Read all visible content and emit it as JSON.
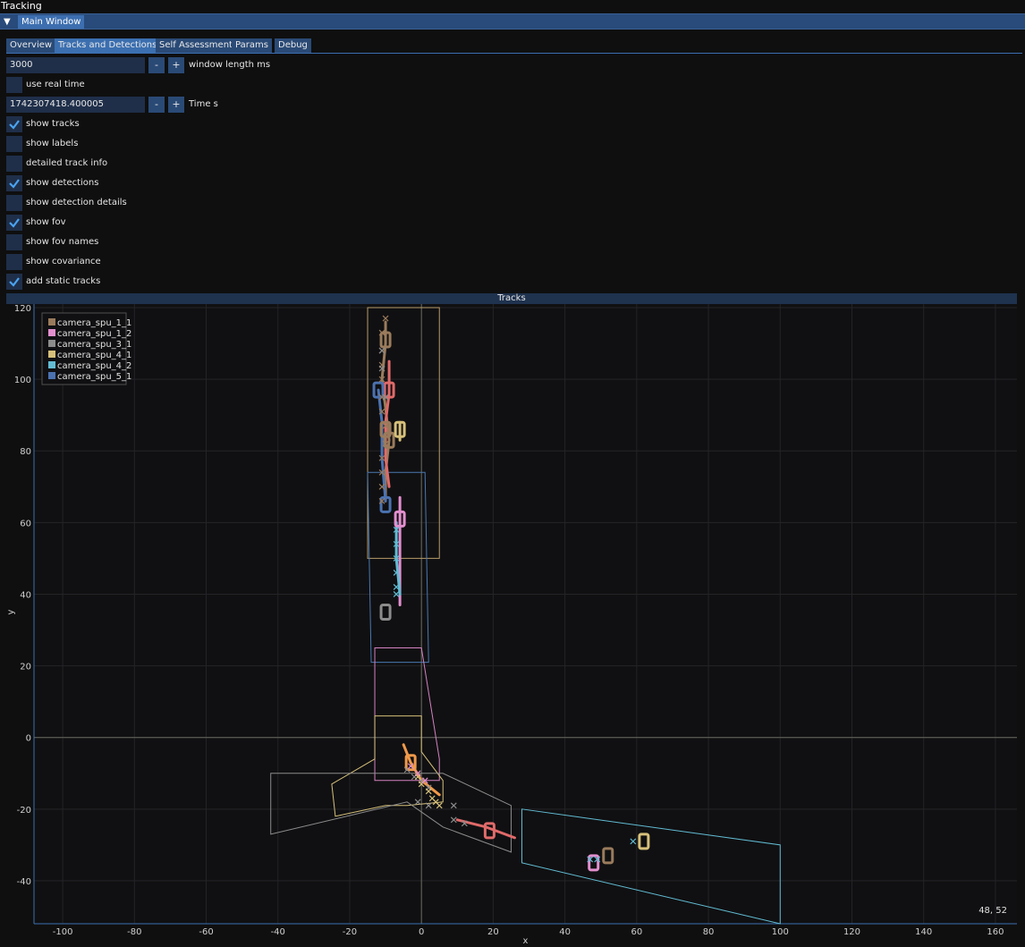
{
  "app": {
    "title": "Tracking"
  },
  "window": {
    "tab_label": "Main Window"
  },
  "tabs": [
    {
      "label": "Overview",
      "active": false
    },
    {
      "label": "Tracks and Detections",
      "active": true
    },
    {
      "label": "Self Assessment",
      "active": false
    },
    {
      "label": "Params",
      "active": false
    },
    {
      "label": "Debug",
      "active": false
    }
  ],
  "controls": {
    "window_length": {
      "value": "3000",
      "label": "window length ms",
      "minus": "-",
      "plus": "+"
    },
    "use_real_time": {
      "label": "use real time",
      "checked": false
    },
    "time": {
      "value": "1742307418.400005",
      "label": "Time s",
      "minus": "-",
      "plus": "+"
    },
    "checkboxes": [
      {
        "label": "show tracks",
        "checked": true
      },
      {
        "label": "show labels",
        "checked": false
      },
      {
        "label": "detailed track info",
        "checked": false
      },
      {
        "label": "show detections",
        "checked": true
      },
      {
        "label": "show detection details",
        "checked": false
      },
      {
        "label": "show fov",
        "checked": true
      },
      {
        "label": "show fov names",
        "checked": false
      },
      {
        "label": "show covariance",
        "checked": false
      },
      {
        "label": "add static tracks",
        "checked": true
      }
    ]
  },
  "plot": {
    "title": "Tracks",
    "cursor_readout": "48, 52"
  },
  "chart_data": {
    "type": "scatter",
    "title": "Tracks",
    "xlabel": "x",
    "ylabel": "y",
    "xlim": [
      -108,
      166
    ],
    "ylim": [
      -52,
      121
    ],
    "xticks": [
      -100,
      -80,
      -60,
      -40,
      -20,
      0,
      20,
      40,
      60,
      80,
      100,
      120,
      140,
      160
    ],
    "yticks": [
      -40,
      -20,
      0,
      20,
      40,
      60,
      80,
      100,
      120
    ],
    "grid": true,
    "legend_position": "top-left",
    "legend": [
      {
        "name": "camera_spu_1_1",
        "color": "#9a7b5c"
      },
      {
        "name": "camera_spu_1_2",
        "color": "#e38fcf"
      },
      {
        "name": "camera_spu_3_1",
        "color": "#8c8c8c"
      },
      {
        "name": "camera_spu_4_1",
        "color": "#d6c07a"
      },
      {
        "name": "camera_spu_4_2",
        "color": "#62bcd3"
      },
      {
        "name": "camera_spu_5_1",
        "color": "#4b72b0"
      }
    ],
    "fovs": [
      {
        "color": "#b89c6a",
        "points": [
          [
            -15,
            120
          ],
          [
            5,
            120
          ],
          [
            5,
            50
          ],
          [
            -15,
            50
          ]
        ]
      },
      {
        "color": "#4a78b0",
        "points": [
          [
            -15,
            74
          ],
          [
            1,
            74
          ],
          [
            2,
            21
          ],
          [
            -14,
            21
          ]
        ]
      },
      {
        "color": "#d582c2",
        "points": [
          [
            -13,
            25
          ],
          [
            0,
            25
          ],
          [
            5,
            -6
          ],
          [
            5,
            -12
          ],
          [
            -13,
            -12
          ]
        ]
      },
      {
        "color": "#d6c07a",
        "points": [
          [
            -13,
            6
          ],
          [
            0,
            6
          ],
          [
            0,
            -4
          ],
          [
            6,
            -12
          ],
          [
            6,
            -18
          ],
          [
            -4,
            -19
          ],
          [
            -10,
            -19
          ],
          [
            -24,
            -22
          ],
          [
            -25,
            -13
          ],
          [
            -13,
            -6
          ]
        ]
      },
      {
        "color": "#8c8c8c",
        "points": [
          [
            -42,
            -10
          ],
          [
            6,
            -10
          ],
          [
            25,
            -19
          ],
          [
            25,
            -32
          ],
          [
            6,
            -25
          ],
          [
            -4,
            -18
          ],
          [
            -42,
            -27
          ]
        ]
      },
      {
        "color": "#62bcd3",
        "points": [
          [
            28,
            -20
          ],
          [
            100,
            -30
          ],
          [
            100,
            -52
          ],
          [
            28,
            -35
          ]
        ]
      }
    ],
    "tracks": [
      {
        "color": "#9a7b5c",
        "points": [
          [
            -10,
            116
          ],
          [
            -10,
            110
          ],
          [
            -11,
            100
          ],
          [
            -10,
            92
          ],
          [
            -9,
            83
          ],
          [
            -10,
            74
          ],
          [
            -10,
            66
          ]
        ]
      },
      {
        "color": "#e06a6a",
        "points": [
          [
            -9,
            105
          ],
          [
            -9,
            96
          ],
          [
            -10,
            88
          ],
          [
            -10,
            78
          ],
          [
            -9,
            70
          ]
        ]
      },
      {
        "color": "#4b72b0",
        "points": [
          [
            -12,
            97
          ],
          [
            -11,
            88
          ],
          [
            -11,
            78
          ],
          [
            -10,
            66
          ]
        ]
      },
      {
        "color": "#e38fcf",
        "points": [
          [
            -6,
            67
          ],
          [
            -6,
            58
          ],
          [
            -6,
            48
          ],
          [
            -6,
            37
          ]
        ]
      },
      {
        "color": "#62bcd3",
        "points": [
          [
            -7,
            60
          ],
          [
            -7,
            50
          ],
          [
            -6,
            40
          ]
        ]
      },
      {
        "color": "#d6c07a",
        "points": [
          [
            -6,
            88
          ],
          [
            -6,
            85
          ],
          [
            -6,
            83
          ]
        ]
      },
      {
        "color": "#f0994a",
        "points": [
          [
            -5,
            -2
          ],
          [
            -3,
            -7
          ],
          [
            0,
            -12
          ],
          [
            5,
            -16
          ]
        ]
      },
      {
        "color": "#e06a6a",
        "points": [
          [
            10,
            -23
          ],
          [
            18,
            -25
          ],
          [
            26,
            -28
          ]
        ]
      }
    ],
    "boxes": [
      {
        "color": "#9a7b5c",
        "points": [
          [
            -10,
            111
          ],
          [
            -10,
            86
          ],
          [
            -9,
            83
          ],
          [
            52,
            -33
          ]
        ]
      },
      {
        "color": "#e06a6a",
        "points": [
          [
            -9,
            97
          ],
          [
            19,
            -26
          ]
        ]
      },
      {
        "color": "#4b72b0",
        "points": [
          [
            -12,
            97
          ],
          [
            -10,
            65
          ]
        ]
      },
      {
        "color": "#e38fcf",
        "points": [
          [
            -6,
            61
          ],
          [
            48,
            -35
          ]
        ]
      },
      {
        "color": "#8c8c8c",
        "points": [
          [
            -10,
            35
          ]
        ]
      },
      {
        "color": "#d6c07a",
        "points": [
          [
            -6,
            86
          ],
          [
            62,
            -29
          ]
        ]
      },
      {
        "color": "#f0994a",
        "points": [
          [
            -3,
            -7
          ]
        ]
      }
    ],
    "detections": [
      {
        "color": "#9a7b5c",
        "points": [
          [
            -10,
            117
          ],
          [
            -11,
            113
          ],
          [
            -11,
            108
          ],
          [
            -11,
            104
          ],
          [
            -11,
            100
          ],
          [
            -11,
            95
          ],
          [
            -11,
            91
          ],
          [
            -10,
            87
          ],
          [
            -10,
            82
          ],
          [
            -11,
            78
          ],
          [
            -11,
            74
          ],
          [
            -11,
            70
          ],
          [
            -11,
            66
          ]
        ]
      },
      {
        "color": "#8c8c8c",
        "points": [
          [
            -11,
            108
          ],
          [
            -11,
            103
          ],
          [
            -10,
            95
          ],
          [
            -4,
            -9
          ],
          [
            -2,
            -11
          ],
          [
            0,
            -12
          ],
          [
            2,
            -14
          ],
          [
            -1,
            -18
          ],
          [
            2,
            -19
          ],
          [
            9,
            -19
          ],
          [
            9,
            -23
          ],
          [
            12,
            -24
          ]
        ]
      },
      {
        "color": "#62bcd3",
        "points": [
          [
            -7,
            58
          ],
          [
            -7,
            54
          ],
          [
            -7,
            50
          ],
          [
            -7,
            46
          ],
          [
            -7,
            42
          ],
          [
            -7,
            40
          ],
          [
            47,
            -34
          ],
          [
            59,
            -29
          ],
          [
            49,
            -34
          ]
        ]
      },
      {
        "color": "#d6c07a",
        "points": [
          [
            -1,
            -11
          ],
          [
            0,
            -13
          ],
          [
            2,
            -15
          ],
          [
            3,
            -17
          ],
          [
            4,
            -18
          ],
          [
            5,
            -19
          ]
        ]
      },
      {
        "color": "#e38fcf",
        "points": [
          [
            -1,
            -10
          ],
          [
            1,
            -12
          ],
          [
            -3,
            -8
          ]
        ]
      }
    ]
  }
}
